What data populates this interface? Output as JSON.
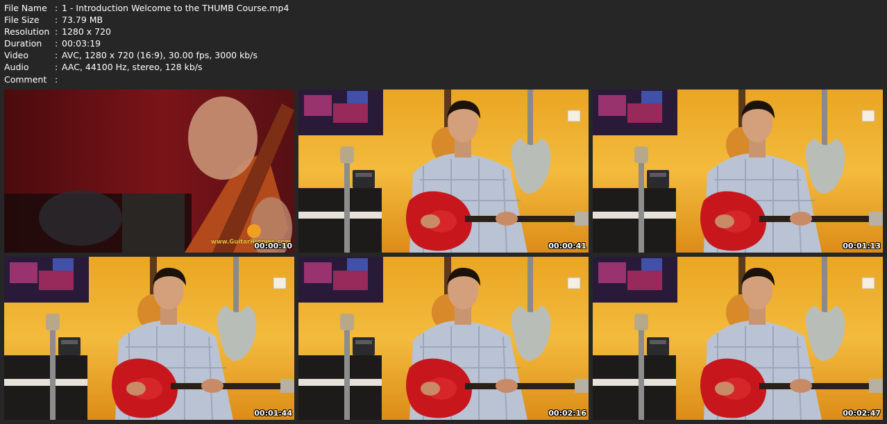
{
  "file_info": [
    {
      "label": "File Name",
      "value": "1 - Introduction Welcome to the THUMB Course.mp4"
    },
    {
      "label": "File Size",
      "value": "73.79 MB"
    },
    {
      "label": "Resolution",
      "value": "1280 x 720"
    },
    {
      "label": "Duration",
      "value": "00:03:19"
    },
    {
      "label": "Video",
      "value": "AVC, 1280 x 720 (16:9), 30.00 fps, 3000 kb/s"
    },
    {
      "label": "Audio",
      "value": "AAC, 44100 Hz, stereo, 128 kb/s"
    },
    {
      "label": "Comment",
      "value": ""
    }
  ],
  "separator": ":",
  "thumbnails": [
    {
      "timestamp": "00:00:10",
      "watermark": "www.GuitarHippies.com",
      "scene": "close-up"
    },
    {
      "timestamp": "00:00:41",
      "scene": "presenter"
    },
    {
      "timestamp": "00:01:13",
      "scene": "presenter"
    },
    {
      "timestamp": "00:01:44",
      "scene": "presenter"
    },
    {
      "timestamp": "00:02:16",
      "scene": "presenter"
    },
    {
      "timestamp": "00:02:47",
      "scene": "presenter"
    }
  ],
  "colors": {
    "background": "#262626",
    "wall": "#efb233",
    "guitar_red": "#c8161d",
    "shirt": "#b9c3d4",
    "text": "#ffffff"
  }
}
